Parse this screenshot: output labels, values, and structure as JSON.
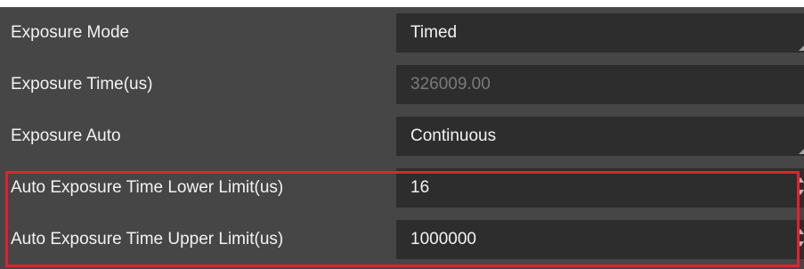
{
  "properties": [
    {
      "label": "Exposure Mode",
      "value": "Timed",
      "control": "dropdown",
      "enabled": true
    },
    {
      "label": "Exposure Time(us)",
      "value": "326009.00",
      "control": "number",
      "enabled": false
    },
    {
      "label": "Exposure Auto",
      "value": "Continuous",
      "control": "dropdown",
      "enabled": true
    },
    {
      "label": "Auto Exposure Time Lower Limit(us)",
      "value": "16",
      "control": "spinbox",
      "enabled": true
    },
    {
      "label": "Auto Exposure Time Upper Limit(us)",
      "value": "1000000",
      "control": "spinbox",
      "enabled": true
    }
  ],
  "colors": {
    "panel_background": "#464646",
    "field_background": "#2d2d2d",
    "text": "#f2f2f2",
    "disabled_text": "#7a7a7a",
    "highlight_border": "#e0232e"
  }
}
